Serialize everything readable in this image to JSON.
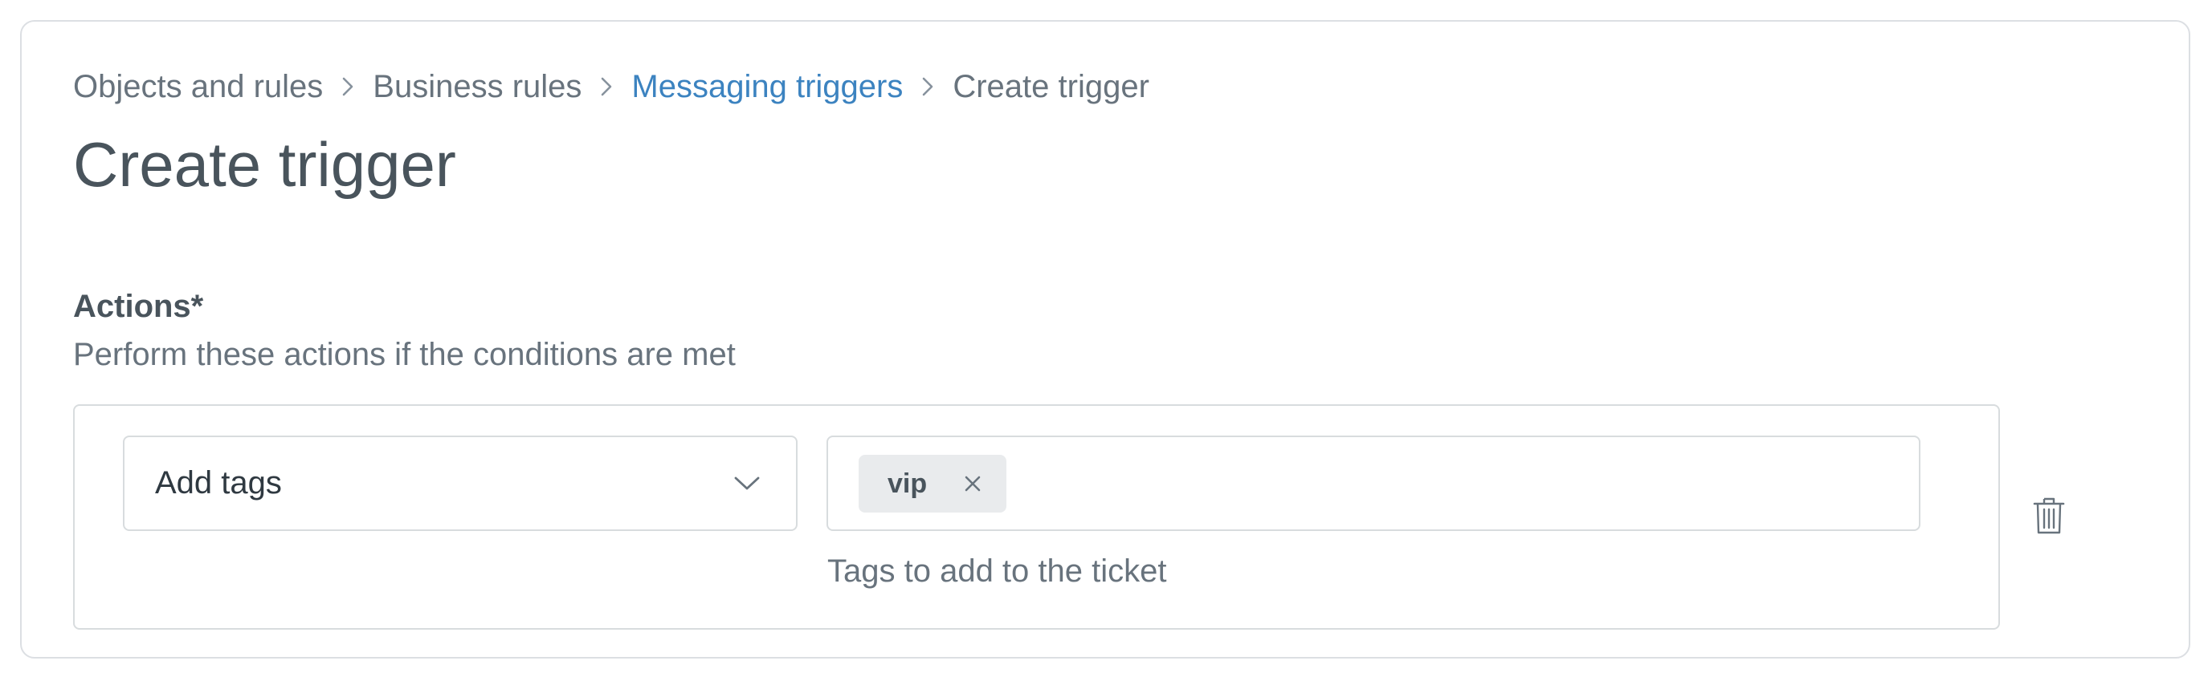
{
  "breadcrumb": {
    "items": [
      "Objects and rules",
      "Business rules",
      "Messaging triggers",
      "Create trigger"
    ]
  },
  "page": {
    "title": "Create trigger"
  },
  "actions": {
    "label": "Actions*",
    "hint": "Perform these actions if the conditions are met",
    "rows": [
      {
        "action_select_value": "Add tags",
        "tags": [
          "vip"
        ],
        "field_hint": "Tags to add to the ticket"
      }
    ]
  },
  "colors": {
    "link": "#3c83c0",
    "text_primary": "#49545c",
    "text_secondary": "#68737d",
    "border": "#d8dcde",
    "chip_bg": "#e9ebed"
  },
  "icons": {
    "separator": "chevron-right-icon",
    "select": "chevron-down-icon",
    "tag_remove": "close-icon",
    "row_remove": "trash-icon"
  }
}
